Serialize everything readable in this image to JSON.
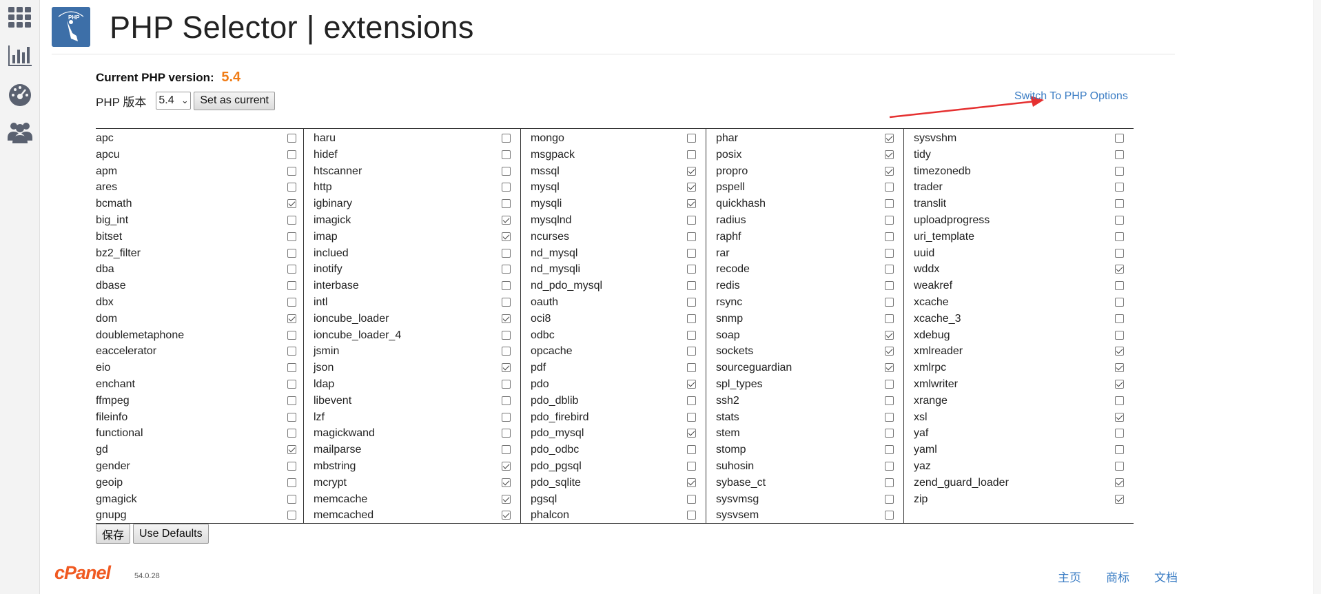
{
  "title": "PHP Selector | extensions",
  "current_version_label": "Current PHP version:",
  "current_version": "5.4",
  "select_label": "PHP 版本",
  "select_value": "5.4",
  "set_current_label": "Set as current",
  "switch_link": "Switch To PHP Options",
  "save_label": "保存",
  "defaults_label": "Use Defaults",
  "cpanel_version": "54.0.28",
  "cpanel_logo": "cPanel",
  "footer_links": [
    "主页",
    "商标",
    "文档"
  ],
  "columns": [
    [
      {
        "name": "apc",
        "checked": false
      },
      {
        "name": "apcu",
        "checked": false
      },
      {
        "name": "apm",
        "checked": false
      },
      {
        "name": "ares",
        "checked": false
      },
      {
        "name": "bcmath",
        "checked": true
      },
      {
        "name": "big_int",
        "checked": false
      },
      {
        "name": "bitset",
        "checked": false
      },
      {
        "name": "bz2_filter",
        "checked": false
      },
      {
        "name": "dba",
        "checked": false
      },
      {
        "name": "dbase",
        "checked": false
      },
      {
        "name": "dbx",
        "checked": false
      },
      {
        "name": "dom",
        "checked": true
      },
      {
        "name": "doublemetaphone",
        "checked": false
      },
      {
        "name": "eaccelerator",
        "checked": false
      },
      {
        "name": "eio",
        "checked": false
      },
      {
        "name": "enchant",
        "checked": false
      },
      {
        "name": "ffmpeg",
        "checked": false
      },
      {
        "name": "fileinfo",
        "checked": false
      },
      {
        "name": "functional",
        "checked": false
      },
      {
        "name": "gd",
        "checked": true
      },
      {
        "name": "gender",
        "checked": false
      },
      {
        "name": "geoip",
        "checked": false
      },
      {
        "name": "gmagick",
        "checked": false
      },
      {
        "name": "gnupg",
        "checked": false
      }
    ],
    [
      {
        "name": "haru",
        "checked": false
      },
      {
        "name": "hidef",
        "checked": false
      },
      {
        "name": "htscanner",
        "checked": false
      },
      {
        "name": "http",
        "checked": false
      },
      {
        "name": "igbinary",
        "checked": false
      },
      {
        "name": "imagick",
        "checked": true
      },
      {
        "name": "imap",
        "checked": true
      },
      {
        "name": "inclued",
        "checked": false
      },
      {
        "name": "inotify",
        "checked": false
      },
      {
        "name": "interbase",
        "checked": false
      },
      {
        "name": "intl",
        "checked": false
      },
      {
        "name": "ioncube_loader",
        "checked": true
      },
      {
        "name": "ioncube_loader_4",
        "checked": false
      },
      {
        "name": "jsmin",
        "checked": false
      },
      {
        "name": "json",
        "checked": true
      },
      {
        "name": "ldap",
        "checked": false
      },
      {
        "name": "libevent",
        "checked": false
      },
      {
        "name": "lzf",
        "checked": false
      },
      {
        "name": "magickwand",
        "checked": false
      },
      {
        "name": "mailparse",
        "checked": false
      },
      {
        "name": "mbstring",
        "checked": true
      },
      {
        "name": "mcrypt",
        "checked": true
      },
      {
        "name": "memcache",
        "checked": true
      },
      {
        "name": "memcached",
        "checked": true
      }
    ],
    [
      {
        "name": "mongo",
        "checked": false
      },
      {
        "name": "msgpack",
        "checked": false
      },
      {
        "name": "mssql",
        "checked": true
      },
      {
        "name": "mysql",
        "checked": true
      },
      {
        "name": "mysqli",
        "checked": true
      },
      {
        "name": "mysqlnd",
        "checked": false
      },
      {
        "name": "ncurses",
        "checked": false
      },
      {
        "name": "nd_mysql",
        "checked": false
      },
      {
        "name": "nd_mysqli",
        "checked": false
      },
      {
        "name": "nd_pdo_mysql",
        "checked": false
      },
      {
        "name": "oauth",
        "checked": false
      },
      {
        "name": "oci8",
        "checked": false
      },
      {
        "name": "odbc",
        "checked": false
      },
      {
        "name": "opcache",
        "checked": false
      },
      {
        "name": "pdf",
        "checked": false
      },
      {
        "name": "pdo",
        "checked": true
      },
      {
        "name": "pdo_dblib",
        "checked": false
      },
      {
        "name": "pdo_firebird",
        "checked": false
      },
      {
        "name": "pdo_mysql",
        "checked": true
      },
      {
        "name": "pdo_odbc",
        "checked": false
      },
      {
        "name": "pdo_pgsql",
        "checked": false
      },
      {
        "name": "pdo_sqlite",
        "checked": true
      },
      {
        "name": "pgsql",
        "checked": false
      },
      {
        "name": "phalcon",
        "checked": false
      }
    ],
    [
      {
        "name": "phar",
        "checked": true
      },
      {
        "name": "posix",
        "checked": true
      },
      {
        "name": "propro",
        "checked": true
      },
      {
        "name": "pspell",
        "checked": false
      },
      {
        "name": "quickhash",
        "checked": false
      },
      {
        "name": "radius",
        "checked": false
      },
      {
        "name": "raphf",
        "checked": false
      },
      {
        "name": "rar",
        "checked": false
      },
      {
        "name": "recode",
        "checked": false
      },
      {
        "name": "redis",
        "checked": false
      },
      {
        "name": "rsync",
        "checked": false
      },
      {
        "name": "snmp",
        "checked": false
      },
      {
        "name": "soap",
        "checked": true
      },
      {
        "name": "sockets",
        "checked": true
      },
      {
        "name": "sourceguardian",
        "checked": true
      },
      {
        "name": "spl_types",
        "checked": false
      },
      {
        "name": "ssh2",
        "checked": false
      },
      {
        "name": "stats",
        "checked": false
      },
      {
        "name": "stem",
        "checked": false
      },
      {
        "name": "stomp",
        "checked": false
      },
      {
        "name": "suhosin",
        "checked": false
      },
      {
        "name": "sybase_ct",
        "checked": false
      },
      {
        "name": "sysvmsg",
        "checked": false
      },
      {
        "name": "sysvsem",
        "checked": false
      }
    ],
    [
      {
        "name": "sysvshm",
        "checked": false
      },
      {
        "name": "tidy",
        "checked": false
      },
      {
        "name": "timezonedb",
        "checked": false
      },
      {
        "name": "trader",
        "checked": false
      },
      {
        "name": "translit",
        "checked": false
      },
      {
        "name": "uploadprogress",
        "checked": false
      },
      {
        "name": "uri_template",
        "checked": false
      },
      {
        "name": "uuid",
        "checked": false
      },
      {
        "name": "wddx",
        "checked": true
      },
      {
        "name": "weakref",
        "checked": false
      },
      {
        "name": "xcache",
        "checked": false
      },
      {
        "name": "xcache_3",
        "checked": false
      },
      {
        "name": "xdebug",
        "checked": false
      },
      {
        "name": "xmlreader",
        "checked": true
      },
      {
        "name": "xmlrpc",
        "checked": true
      },
      {
        "name": "xmlwriter",
        "checked": true
      },
      {
        "name": "xrange",
        "checked": false
      },
      {
        "name": "xsl",
        "checked": true
      },
      {
        "name": "yaf",
        "checked": false
      },
      {
        "name": "yaml",
        "checked": false
      },
      {
        "name": "yaz",
        "checked": false
      },
      {
        "name": "zend_guard_loader",
        "checked": true
      },
      {
        "name": "zip",
        "checked": true
      }
    ]
  ]
}
